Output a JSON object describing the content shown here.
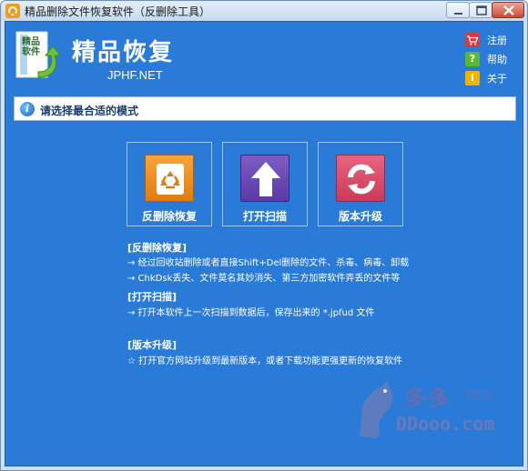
{
  "window": {
    "title": "精品删除文件恢复软件（反删除工具）"
  },
  "header": {
    "logo_title": "精品恢复",
    "logo_url": "JPHF.NET",
    "logo_badge": "精品软件"
  },
  "side_links": [
    {
      "label": "注册",
      "icon": "shopping-cart-icon"
    },
    {
      "label": "帮助",
      "icon": "help-icon"
    },
    {
      "label": "关于",
      "icon": "info-icon"
    }
  ],
  "info_bar": {
    "text": "请选择最合适的模式"
  },
  "modes": [
    {
      "label": "反删除恢复",
      "icon": "recycle-icon"
    },
    {
      "label": "打开扫描",
      "icon": "upload-arrow-icon"
    },
    {
      "label": "版本升级",
      "icon": "refresh-icon"
    }
  ],
  "descriptions": {
    "undelete_title": "[反删除恢复]",
    "undelete_line1": "→ 经过回收站删除或者直接Shift+Del删除的文件、杀毒、病毒、卸载",
    "undelete_line2": "→ ChkDsk丢失、文件莫名其妙消失、第三方加密软件弄丢的文件等",
    "scan_title": "[打开扫描]",
    "scan_line1": "→ 打开本软件上一次扫描到数据后，保存出来的 *.jpfud 文件",
    "upgrade_title": "[版本升级]",
    "upgrade_line1": "☆ 打开官方网站升级到最新版本，或者下载功能更强更新的恢复软件"
  },
  "watermark": {
    "big": "多多",
    "small": "软件站",
    "url": "DDooo.com"
  },
  "colors": {
    "client_bg": "#2a7bd8",
    "accent_orange": "#f29b1f",
    "accent_purple": "#6a48b5",
    "accent_pink": "#d94a69"
  }
}
